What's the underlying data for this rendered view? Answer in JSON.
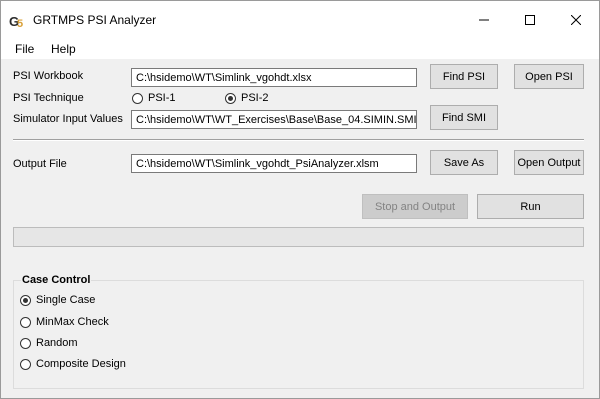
{
  "window": {
    "title": "GRTMPS PSI Analyzer",
    "minimize_icon": "minimize-icon",
    "maximize_icon": "maximize-icon",
    "close_icon": "close-icon"
  },
  "menu": {
    "file": "File",
    "help": "Help"
  },
  "form": {
    "psi_workbook_label": "PSI Workbook",
    "psi_workbook_value": "C:\\hsidemo\\WT\\Simlink_vgohdt.xlsx",
    "psi_technique_label": "PSI Technique",
    "psi1_label": "PSI-1",
    "psi2_label": "PSI-2",
    "psi_technique_selected": "PSI-2",
    "simulator_input_label": "Simulator Input Values",
    "simulator_input_value": "C:\\hsidemo\\WT\\WT_Exercises\\Base\\Base_04.SIMIN.SMI",
    "output_file_label": "Output File",
    "output_file_value": "C:\\hsidemo\\WT\\Simlink_vgohdt_PsiAnalyzer.xlsm"
  },
  "buttons": {
    "find_psi": "Find PSI",
    "open_psi": "Open PSI",
    "find_smi": "Find SMI",
    "save_as": "Save As",
    "open_output": "Open Output",
    "stop_and_output": "Stop and Output",
    "run": "Run"
  },
  "progress": {
    "value": 0
  },
  "case_control": {
    "title": "Case Control",
    "selected": "Single Case",
    "options": [
      "Single Case",
      "MinMax Check",
      "Random",
      "Composite Design"
    ]
  },
  "colors": {
    "window_bg": "#f0f0f0",
    "titlebar_bg": "#ffffff",
    "icon_dark": "#2b2b2b",
    "icon_accent": "#d9a13a"
  }
}
